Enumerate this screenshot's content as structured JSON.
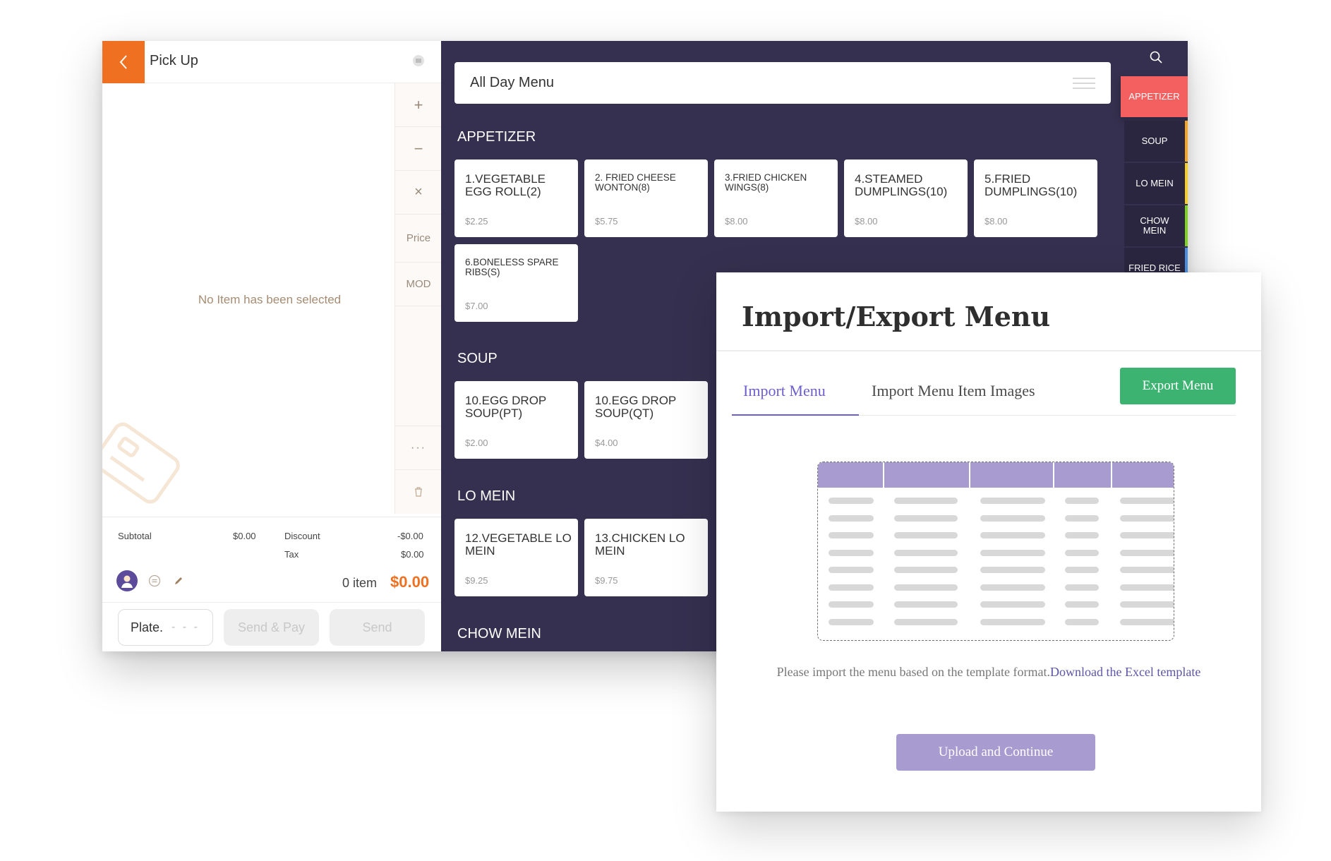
{
  "pos": {
    "order_type": "Pick Up",
    "tools": {
      "add": "+",
      "minus": "−",
      "remove": "×",
      "price": "Price",
      "mod": "MOD",
      "more": "···"
    },
    "empty_message": "No Item has been selected",
    "summary": {
      "subtotal_label": "Subtotal",
      "subtotal": "$0.00",
      "discount_label": "Discount",
      "discount": "-$0.00",
      "tax_label": "Tax",
      "tax": "$0.00",
      "item_count": "0 item",
      "total": "$0.00"
    },
    "buttons": {
      "plate": "Plate.",
      "plate_dash": "- - -",
      "send_pay": "Send & Pay",
      "send": "Send"
    },
    "accent_color": "#f07021"
  },
  "menu": {
    "name": "All Day Menu",
    "sections": [
      {
        "name": "APPETIZER",
        "items": [
          {
            "name": "1.VEGETABLE EGG ROLL(2)",
            "price": "$2.25"
          },
          {
            "name": "2. FRIED CHEESE WONTON(8)",
            "price": "$5.75"
          },
          {
            "name": "3.FRIED CHICKEN WINGS(8)",
            "price": "$8.00"
          },
          {
            "name": "4.STEAMED DUMPLINGS(10)",
            "price": "$8.00"
          },
          {
            "name": "5.FRIED DUMPLINGS(10)",
            "price": "$8.00"
          },
          {
            "name": "6.BONELESS SPARE RIBS(S)",
            "price": "$7.00"
          }
        ]
      },
      {
        "name": "SOUP",
        "items": [
          {
            "name": "10.EGG DROP SOUP(PT)",
            "price": "$2.00"
          },
          {
            "name": "10.EGG DROP SOUP(QT)",
            "price": "$4.00"
          }
        ]
      },
      {
        "name": "LO MEIN",
        "items": [
          {
            "name": "12.VEGETABLE LO MEIN",
            "price": "$9.25"
          },
          {
            "name": "13.CHICKEN LO MEIN",
            "price": "$9.75"
          }
        ]
      },
      {
        "name": "CHOW MEIN",
        "items": []
      }
    ],
    "categories": [
      {
        "label": "APPETIZER",
        "color": "#f4605f"
      },
      {
        "label": "SOUP",
        "color": "#f5a623"
      },
      {
        "label": "LO MEIN",
        "color": "#f5d023"
      },
      {
        "label": "CHOW MEIN",
        "color": "#7ed321"
      },
      {
        "label": "FRIED RICE",
        "color": "#4a90e2"
      }
    ],
    "bg_color": "#35304f"
  },
  "modal": {
    "title": "Import/Export Menu",
    "tabs": [
      "Import Menu",
      "Import Menu Item Images"
    ],
    "export_button": "Export Menu",
    "note": "Please import the menu based on the template format.",
    "note_link": "Download the Excel template",
    "upload_button": "Upload and Continue",
    "accent_color": "#6d5ed0",
    "export_color": "#3cb371"
  }
}
